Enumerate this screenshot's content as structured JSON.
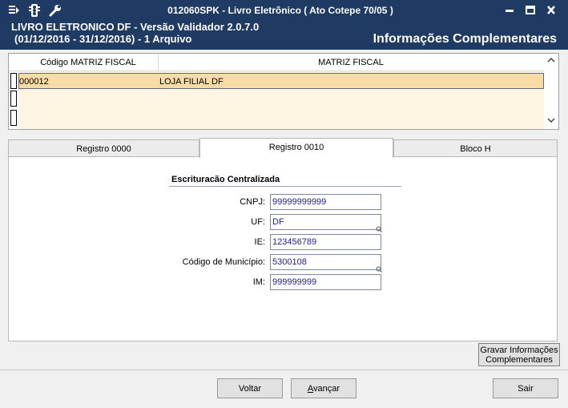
{
  "window": {
    "title": "012060SPK - Livro Eletrônico ( Ato Cotepe 70/05 )",
    "header_line1": "LIVRO ELETRONICO DF - Versão Validador 2.0.7.0",
    "header_line2": "(01/12/2016 - 31/12/2016) - 1 Arquivo",
    "header_right": "Informações Complementares"
  },
  "grid": {
    "columns": [
      "Código MATRIZ FISCAL",
      "MATRIZ FISCAL"
    ],
    "rows": [
      {
        "codigo": "000012",
        "matriz": "LOJA FILIAL DF"
      }
    ]
  },
  "tabs": [
    {
      "label": "Registro 0000"
    },
    {
      "label": "Registro 0010"
    },
    {
      "label": "Bloco H"
    }
  ],
  "form": {
    "section_title": "Escrituracão Centralizada",
    "cnpj_label": "CNPJ:",
    "cnpj_value": "99999999999",
    "uf_label": "UF:",
    "uf_value": "DF",
    "ie_label": "IE:",
    "ie_value": "123456789",
    "municipio_label": "Código de Município:",
    "municipio_value": "5300108",
    "im_label": "IM:",
    "im_value": "999999999"
  },
  "buttons": {
    "save_line1": "Gravar Informações",
    "save_line2": "Complementares",
    "back": "Voltar",
    "next_mnemonic": "A",
    "next_rest": "vançar",
    "exit": "Sair"
  },
  "colors": {
    "title_bar": "#1f3a63",
    "grid_background": "#fdf4e2",
    "selected_row": "#f8dba5",
    "input_text": "#1a1aa0"
  }
}
